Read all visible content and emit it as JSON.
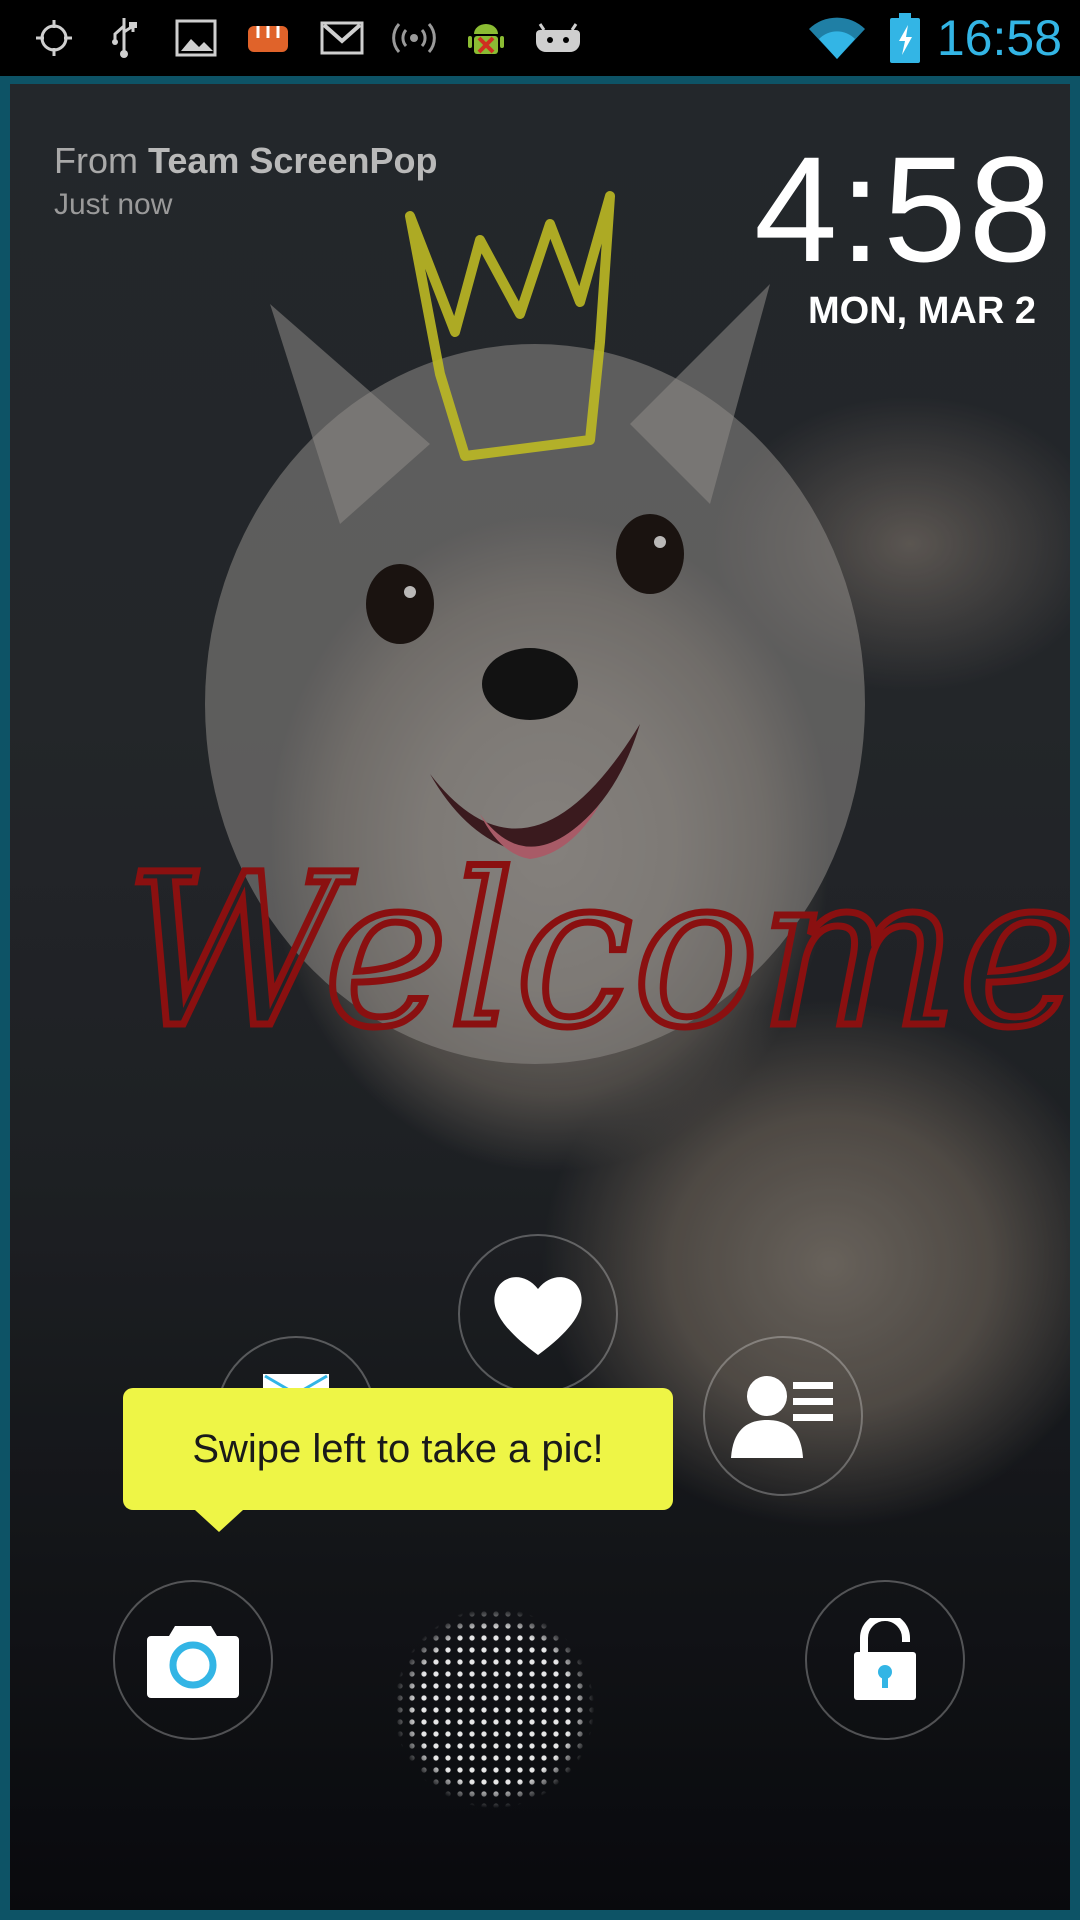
{
  "status_bar": {
    "time": "16:58",
    "left_icons": [
      "crosshair-icon",
      "usb-icon",
      "image-icon",
      "fist-icon",
      "gmail-icon",
      "broadcast-icon",
      "android-debug-icon",
      "game-controller-icon"
    ],
    "right_icons": [
      "wifi-icon",
      "battery-charging-icon"
    ],
    "accent_color": "#33b5e5"
  },
  "notification": {
    "from_prefix": "From",
    "sender": "Team ScreenPop",
    "time": "Just now"
  },
  "clock": {
    "time": "4:58",
    "date": "MON, MAR 2"
  },
  "wallpaper": {
    "doodle_text": "Welcome!",
    "doodle_color": "#8a1010",
    "crown_color": "#bdb924"
  },
  "glowpad": {
    "targets": [
      "heart-target",
      "contacts-target",
      "camera-target",
      "unlock-target",
      "partially-hidden-target"
    ],
    "hint": "Swipe left to take a pic!",
    "hint_color": "#eef546"
  }
}
